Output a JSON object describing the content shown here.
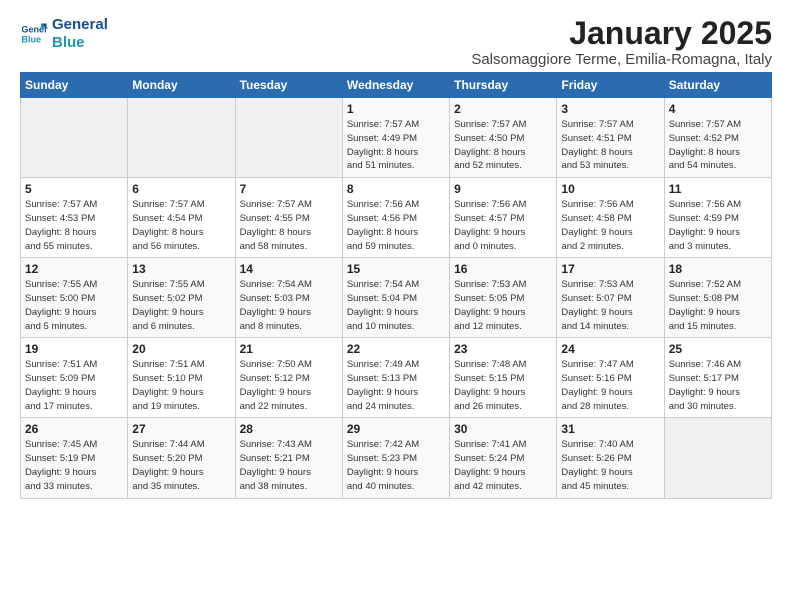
{
  "logo": {
    "line1": "General",
    "line2": "Blue"
  },
  "title": "January 2025",
  "location": "Salsomaggiore Terme, Emilia-Romagna, Italy",
  "days_of_week": [
    "Sunday",
    "Monday",
    "Tuesday",
    "Wednesday",
    "Thursday",
    "Friday",
    "Saturday"
  ],
  "weeks": [
    [
      {
        "day": "",
        "content": ""
      },
      {
        "day": "",
        "content": ""
      },
      {
        "day": "",
        "content": ""
      },
      {
        "day": "1",
        "content": "Sunrise: 7:57 AM\nSunset: 4:49 PM\nDaylight: 8 hours\nand 51 minutes."
      },
      {
        "day": "2",
        "content": "Sunrise: 7:57 AM\nSunset: 4:50 PM\nDaylight: 8 hours\nand 52 minutes."
      },
      {
        "day": "3",
        "content": "Sunrise: 7:57 AM\nSunset: 4:51 PM\nDaylight: 8 hours\nand 53 minutes."
      },
      {
        "day": "4",
        "content": "Sunrise: 7:57 AM\nSunset: 4:52 PM\nDaylight: 8 hours\nand 54 minutes."
      }
    ],
    [
      {
        "day": "5",
        "content": "Sunrise: 7:57 AM\nSunset: 4:53 PM\nDaylight: 8 hours\nand 55 minutes."
      },
      {
        "day": "6",
        "content": "Sunrise: 7:57 AM\nSunset: 4:54 PM\nDaylight: 8 hours\nand 56 minutes."
      },
      {
        "day": "7",
        "content": "Sunrise: 7:57 AM\nSunset: 4:55 PM\nDaylight: 8 hours\nand 58 minutes."
      },
      {
        "day": "8",
        "content": "Sunrise: 7:56 AM\nSunset: 4:56 PM\nDaylight: 8 hours\nand 59 minutes."
      },
      {
        "day": "9",
        "content": "Sunrise: 7:56 AM\nSunset: 4:57 PM\nDaylight: 9 hours\nand 0 minutes."
      },
      {
        "day": "10",
        "content": "Sunrise: 7:56 AM\nSunset: 4:58 PM\nDaylight: 9 hours\nand 2 minutes."
      },
      {
        "day": "11",
        "content": "Sunrise: 7:56 AM\nSunset: 4:59 PM\nDaylight: 9 hours\nand 3 minutes."
      }
    ],
    [
      {
        "day": "12",
        "content": "Sunrise: 7:55 AM\nSunset: 5:00 PM\nDaylight: 9 hours\nand 5 minutes."
      },
      {
        "day": "13",
        "content": "Sunrise: 7:55 AM\nSunset: 5:02 PM\nDaylight: 9 hours\nand 6 minutes."
      },
      {
        "day": "14",
        "content": "Sunrise: 7:54 AM\nSunset: 5:03 PM\nDaylight: 9 hours\nand 8 minutes."
      },
      {
        "day": "15",
        "content": "Sunrise: 7:54 AM\nSunset: 5:04 PM\nDaylight: 9 hours\nand 10 minutes."
      },
      {
        "day": "16",
        "content": "Sunrise: 7:53 AM\nSunset: 5:05 PM\nDaylight: 9 hours\nand 12 minutes."
      },
      {
        "day": "17",
        "content": "Sunrise: 7:53 AM\nSunset: 5:07 PM\nDaylight: 9 hours\nand 14 minutes."
      },
      {
        "day": "18",
        "content": "Sunrise: 7:52 AM\nSunset: 5:08 PM\nDaylight: 9 hours\nand 15 minutes."
      }
    ],
    [
      {
        "day": "19",
        "content": "Sunrise: 7:51 AM\nSunset: 5:09 PM\nDaylight: 9 hours\nand 17 minutes."
      },
      {
        "day": "20",
        "content": "Sunrise: 7:51 AM\nSunset: 5:10 PM\nDaylight: 9 hours\nand 19 minutes."
      },
      {
        "day": "21",
        "content": "Sunrise: 7:50 AM\nSunset: 5:12 PM\nDaylight: 9 hours\nand 22 minutes."
      },
      {
        "day": "22",
        "content": "Sunrise: 7:49 AM\nSunset: 5:13 PM\nDaylight: 9 hours\nand 24 minutes."
      },
      {
        "day": "23",
        "content": "Sunrise: 7:48 AM\nSunset: 5:15 PM\nDaylight: 9 hours\nand 26 minutes."
      },
      {
        "day": "24",
        "content": "Sunrise: 7:47 AM\nSunset: 5:16 PM\nDaylight: 9 hours\nand 28 minutes."
      },
      {
        "day": "25",
        "content": "Sunrise: 7:46 AM\nSunset: 5:17 PM\nDaylight: 9 hours\nand 30 minutes."
      }
    ],
    [
      {
        "day": "26",
        "content": "Sunrise: 7:45 AM\nSunset: 5:19 PM\nDaylight: 9 hours\nand 33 minutes."
      },
      {
        "day": "27",
        "content": "Sunrise: 7:44 AM\nSunset: 5:20 PM\nDaylight: 9 hours\nand 35 minutes."
      },
      {
        "day": "28",
        "content": "Sunrise: 7:43 AM\nSunset: 5:21 PM\nDaylight: 9 hours\nand 38 minutes."
      },
      {
        "day": "29",
        "content": "Sunrise: 7:42 AM\nSunset: 5:23 PM\nDaylight: 9 hours\nand 40 minutes."
      },
      {
        "day": "30",
        "content": "Sunrise: 7:41 AM\nSunset: 5:24 PM\nDaylight: 9 hours\nand 42 minutes."
      },
      {
        "day": "31",
        "content": "Sunrise: 7:40 AM\nSunset: 5:26 PM\nDaylight: 9 hours\nand 45 minutes."
      },
      {
        "day": "",
        "content": ""
      }
    ]
  ]
}
